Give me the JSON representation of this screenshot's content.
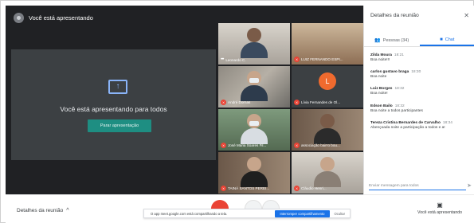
{
  "topbar": {
    "presenting_label": "Você está apresentando"
  },
  "presentation": {
    "message": "Você está apresentando para todos",
    "stop_button": "Parar apresentação"
  },
  "tiles": [
    {
      "name": "Leonardo C.",
      "muted": false,
      "kind": "photo1"
    },
    {
      "name": "LUIZ FERNANDO ESPI...",
      "muted": true,
      "kind": "photo2"
    },
    {
      "name": "André Dornas",
      "muted": true,
      "kind": "photo3"
    },
    {
      "name": "Lívia Fernandes de Ol...",
      "muted": true,
      "kind": "avatar",
      "initial": "L"
    },
    {
      "name": "José Maria Soares Fil...",
      "muted": true,
      "kind": "photo4"
    },
    {
      "name": "associação bairro bou...",
      "muted": true,
      "kind": "photo5"
    },
    {
      "name": "TAINÁ SANTOS PEREI...",
      "muted": true,
      "kind": "photo6"
    },
    {
      "name": "Cláudio Henri...",
      "muted": true,
      "kind": "photo7"
    }
  ],
  "panel": {
    "title": "Detalhes da reunião",
    "close_icon": "close-icon",
    "tab_people": "Pessoas (34)",
    "tab_chat": "Chat",
    "messages": [
      {
        "sender": "Zilda Moura",
        "time": "18:21",
        "text": "Boa noite!!!"
      },
      {
        "sender": "carlos gustavo braga",
        "time": "18:30",
        "text": "Boa noite"
      },
      {
        "sender": "Luiz Borges",
        "time": "18:32",
        "text": "Boa noite!"
      },
      {
        "sender": "Edson Bailo",
        "time": "18:32",
        "text": "Boa noite a todos participantes"
      },
      {
        "sender": "Tereza Cristina Bernardes de Carvalho",
        "time": "18:34",
        "text": "Abençoada noite a participação a todos e a!"
      }
    ],
    "chat_placeholder": "Enviar mensagem para todos"
  },
  "bottom": {
    "details_label": "Detalhes da reunião",
    "present_label": "Você está apresentando"
  },
  "toast": {
    "text": "O app meet.google.com está compartilhando a tela.",
    "stop_button": "Interromper compartilhamento",
    "dismiss": "Ocultar"
  },
  "colors": {
    "accent": "#1a73e8",
    "stop_btn": "#1e8e82",
    "mic_off": "#ea4335",
    "stage_bg": "#202124"
  }
}
